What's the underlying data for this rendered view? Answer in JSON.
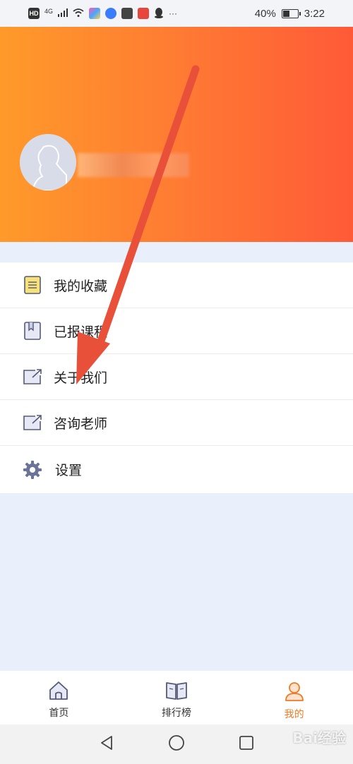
{
  "status": {
    "left_label": "HD",
    "network": "4G",
    "battery_percent": "40%",
    "battery_level": 0.4,
    "time": "3:22"
  },
  "menu": {
    "items": [
      {
        "label": "我的收藏",
        "icon": "notepad-icon"
      },
      {
        "label": "已报课程",
        "icon": "bookmark-book-icon"
      },
      {
        "label": "关于我们",
        "icon": "external-link-icon"
      },
      {
        "label": "咨询老师",
        "icon": "external-link-icon"
      },
      {
        "label": "设置",
        "icon": "gear-icon"
      }
    ]
  },
  "tabbar": {
    "home_label": "首页",
    "ranking_label": "排行榜",
    "mine_label": "我的",
    "active_color": "#f07a22"
  },
  "colors": {
    "hero_start": "#ff9a2a",
    "hero_end": "#ff5a37",
    "annotation_arrow": "#e8503a"
  },
  "watermark": "Bai经验"
}
